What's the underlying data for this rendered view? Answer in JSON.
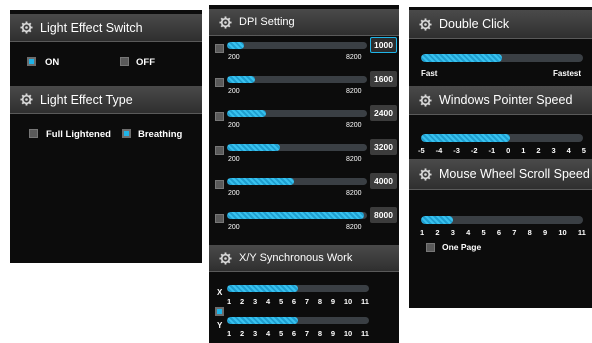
{
  "light_panel": {
    "switch_title": "Light Effect Switch",
    "on_label": "ON",
    "off_label": "OFF",
    "on_checked": true,
    "off_checked": false,
    "type_title": "Light Effect Type",
    "full_label": "Full Lightened",
    "breathing_label": "Breathing",
    "full_checked": false,
    "breathing_checked": true
  },
  "dpi_panel": {
    "title": "DPI Setting",
    "min_label": "200",
    "max_label": "8200",
    "rows": [
      {
        "value": "1000",
        "level": 0.12,
        "selected": true
      },
      {
        "value": "1600",
        "level": 0.2,
        "selected": false
      },
      {
        "value": "2400",
        "level": 0.28,
        "selected": false
      },
      {
        "value": "3200",
        "level": 0.38,
        "selected": false
      },
      {
        "value": "4000",
        "level": 0.48,
        "selected": false
      },
      {
        "value": "8000",
        "level": 0.98,
        "selected": false
      }
    ],
    "sync_title": "X/Y Synchronous Work",
    "x_label": "X",
    "y_label": "Y",
    "sync_checked": true,
    "x_level": 0.5,
    "y_level": 0.5,
    "ticks": [
      "1",
      "2",
      "3",
      "4",
      "5",
      "6",
      "7",
      "8",
      "9",
      "10",
      "11"
    ]
  },
  "pointer_panel": {
    "double_click_title": "Double Click",
    "double_click_level": 0.5,
    "fast_label": "Fast",
    "fastest_label": "Fastest",
    "pointer_title": "Windows Pointer Speed",
    "pointer_level": 0.55,
    "pointer_ticks": [
      "-5",
      "-4",
      "-3",
      "-2",
      "-1",
      "0",
      "1",
      "2",
      "3",
      "4",
      "5"
    ],
    "scroll_title": "Mouse Wheel Scroll Speed",
    "scroll_level": 0.2,
    "scroll_ticks": [
      "1",
      "2",
      "3",
      "4",
      "5",
      "6",
      "7",
      "8",
      "9",
      "10",
      "11"
    ],
    "one_page_label": "One Page",
    "one_page_checked": false
  },
  "colors": {
    "accent": "#1fb4e8",
    "panel_bg": "#0c0c0c",
    "header_bg": "#3c3c3c"
  },
  "icons": {
    "header": "gear-icon"
  }
}
